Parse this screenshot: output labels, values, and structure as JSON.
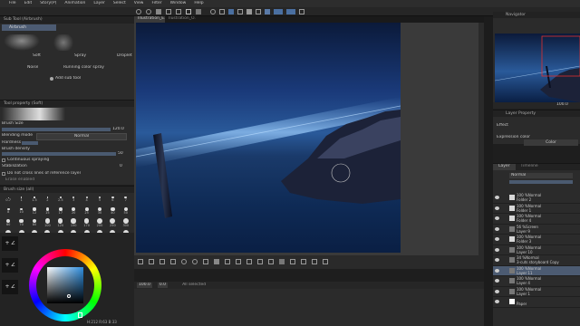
{
  "menu": [
    "File",
    "Edit",
    "Story(P)",
    "Animation",
    "Layer",
    "Select",
    "View",
    "Filter",
    "Window",
    "Help"
  ],
  "subtool_panel": {
    "title": "Sub Tool (Airbrush)",
    "active": "Airbrush",
    "brushes": [
      "Soft",
      "Spray",
      "Droplet",
      "Noise",
      "Running color spray"
    ],
    "add_label": "Add sub tool"
  },
  "tool_property": {
    "title": "Tool property (Soft)",
    "brush_size_label": "Brush Size",
    "brush_size_value": "120.0",
    "blending_label": "Blending mode",
    "blending_value": "Normal",
    "hardness_label": "Hardness",
    "density_label": "Brush density",
    "density_value": "50",
    "continuous_label": "Continuous spraying",
    "stabilization_label": "Stabilization",
    "stabilization_value": "0",
    "no_cross_label": "Do not cross lines of reference layer",
    "erase_label": "Erase enabled"
  },
  "brush_size_panel": {
    "title": "Brush size (all)",
    "sizes": [
      "0.7",
      "1",
      "1.5",
      "2",
      "2.5",
      "3",
      "4",
      "5",
      "6",
      "7",
      "8",
      "10",
      "12",
      "15",
      "17",
      "20",
      "25",
      "30",
      "40",
      "50",
      "60",
      "70",
      "80",
      "100",
      "120",
      "150",
      "170",
      "200",
      "250",
      "300",
      "400",
      "500",
      "600",
      "700",
      "800",
      "1000",
      "1200",
      "1500",
      "1700",
      "2000"
    ]
  },
  "color_wheel": {
    "hue_color": "#2f8fe0",
    "readout": "H:212 R:63 B:33"
  },
  "document_tabs": [
    "Illustration_E.clip",
    "Ilustration_O.clip"
  ],
  "canvas_status": {
    "zoom": "100.0",
    "angle": "0.0",
    "layer_count": "All selected"
  },
  "navigator": {
    "title": "Navigator",
    "zoom": "100.0"
  },
  "layer_property": {
    "title": "Layer Property",
    "effect_label": "Effect",
    "expression_label": "Expression color",
    "expression_value": "Color"
  },
  "layer_panel": {
    "tabs": [
      "Layer",
      "Timeline"
    ],
    "blend_mode": "Normal",
    "layers": [
      {
        "pct": "100 %Normal",
        "name": "Folder 2",
        "type": "folder",
        "selected": false
      },
      {
        "pct": "100 %Normal",
        "name": "Folder 1",
        "type": "folder",
        "selected": false
      },
      {
        "pct": "100 %Normal",
        "name": "Folder 4",
        "type": "folder",
        "selected": false
      },
      {
        "pct": "56 %Screen",
        "name": "Layer 9",
        "type": "layer",
        "selected": false
      },
      {
        "pct": "100 %Normal",
        "name": "Folder 3",
        "type": "folder",
        "selected": false
      },
      {
        "pct": "100 %Normal",
        "name": "Layer 10",
        "type": "layer",
        "selected": false
      },
      {
        "pct": "34 %Normal",
        "name": "3-cuts storyboard Copy",
        "type": "layer",
        "selected": false
      },
      {
        "pct": "100 %Normal",
        "name": "Layer 11",
        "type": "layer",
        "selected": true
      },
      {
        "pct": "100 %Normal",
        "name": "Layer 4",
        "type": "layer",
        "selected": false
      },
      {
        "pct": "100 %Normal",
        "name": "Layer 1",
        "type": "layer",
        "selected": false
      },
      {
        "pct": "",
        "name": "Paper",
        "type": "paper",
        "selected": false
      }
    ]
  },
  "shortcuts": [
    "+ Z",
    "+ Z",
    "+ Z"
  ]
}
